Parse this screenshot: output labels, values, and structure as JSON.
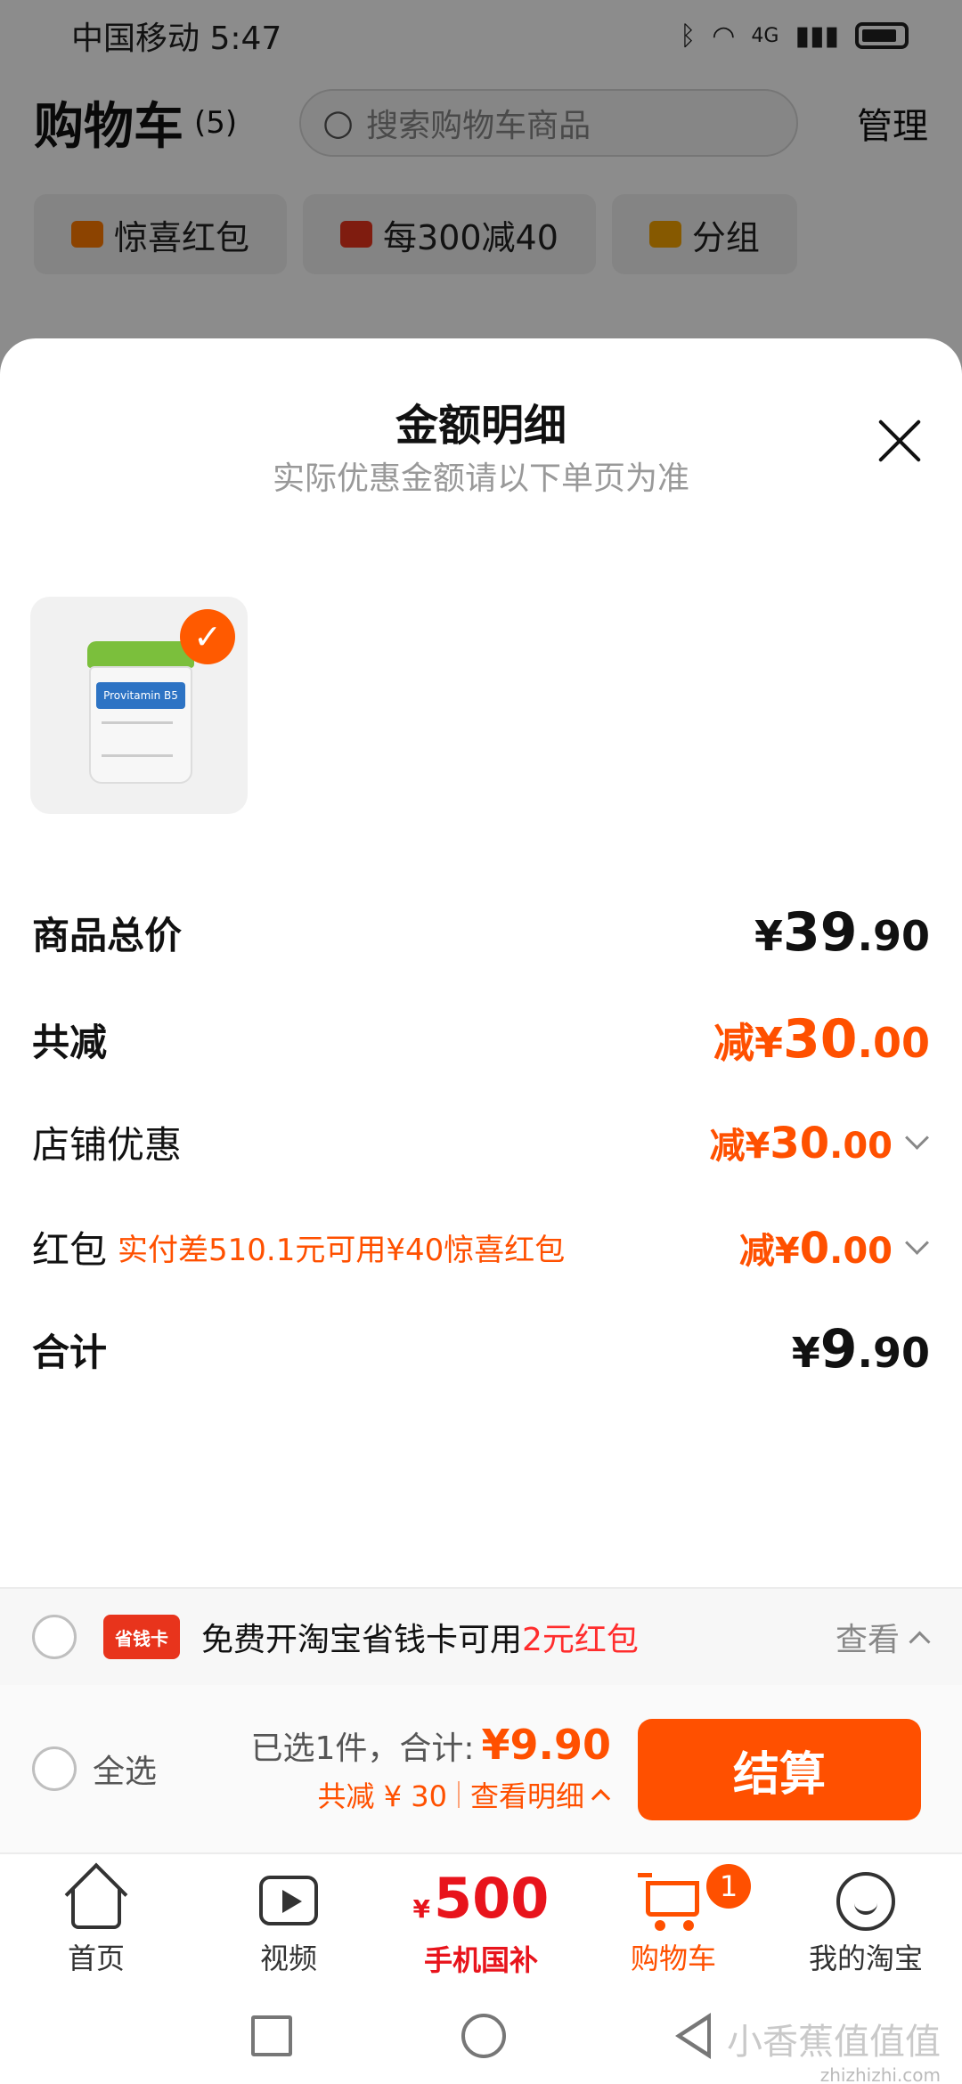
{
  "status_bar": {
    "carrier_time": "中国移动 5:47",
    "network": "4G"
  },
  "cart_header": {
    "title": "购物车",
    "count": "(5)",
    "search_placeholder": "搜索购物车商品",
    "manage": "管理"
  },
  "chips": [
    {
      "label": "惊喜红包",
      "color": "#ff7a00"
    },
    {
      "label": "每300减40",
      "color": "#e8341c"
    },
    {
      "label": "分组",
      "color": "#f5a300"
    }
  ],
  "sheet": {
    "title": "金额明细",
    "subtitle": "实际优惠金额请以下单页为准",
    "product_image_alt": "Provitamin B5",
    "rows": {
      "total_price": {
        "label": "商品总价",
        "currency": "¥",
        "int": "39",
        "dec": ".90"
      },
      "total_discount": {
        "label": "共减",
        "prefix": "减¥",
        "int": "30",
        "dec": ".00"
      },
      "shop_discount": {
        "label": "店铺优惠",
        "prefix": "减¥",
        "int": "30",
        "dec": ".00"
      },
      "red_packet": {
        "label": "红包",
        "note": "实付差510.1元可用¥40惊喜红包",
        "prefix": "减¥",
        "int": "0",
        "dec": ".00"
      },
      "grand_total": {
        "label": "合计",
        "currency": "¥",
        "int": "9",
        "dec": ".90"
      }
    }
  },
  "promo_bar": {
    "card_label": "省钱卡",
    "text": "免费开淘宝省钱卡可用",
    "highlight": "2元红包",
    "view": "查看"
  },
  "checkout": {
    "select_all": "全选",
    "selected": "已选1件，合计:",
    "total": "¥9.90",
    "discount": "共减 ¥ 30",
    "detail": "查看明细",
    "button": "结算"
  },
  "tabbar": {
    "home": "首页",
    "video": "视频",
    "promo_yen": "¥",
    "promo_amount": "500",
    "promo_sub": "手机国补",
    "cart": "购物车",
    "cart_badge": "1",
    "me": "我的淘宝"
  },
  "watermark": {
    "main": "小香蕉值值值",
    "url": "zhizhizhi.com"
  },
  "colors": {
    "accent": "#ff5000",
    "red": "#e8141c",
    "promo_red": "#ff2d2d"
  }
}
